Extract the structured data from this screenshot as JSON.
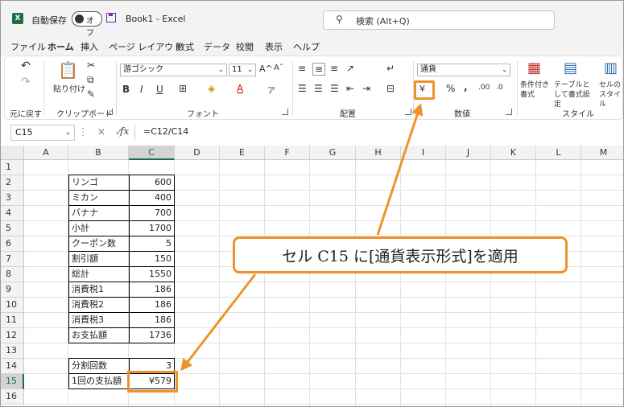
{
  "titlebar": {
    "app_icon": "X",
    "autosave_label": "自動保存",
    "autosave_state": "オフ",
    "doc_title": "Book1  -  Excel",
    "search_placeholder": "検索 (Alt+Q)"
  },
  "menu_tabs": [
    "ファイル",
    "ホーム",
    "挿入",
    "ページ レイアウト",
    "数式",
    "データ",
    "校閲",
    "表示",
    "ヘルプ"
  ],
  "active_tab": "ホーム",
  "ribbon": {
    "undo_group_label": "元に戻す",
    "paste_label": "貼り付け",
    "clipboard_label": "クリップボード",
    "font_name": "游ゴシック",
    "font_size": "11",
    "grow_font": "A^",
    "shrink_font": "Aˇ",
    "bold": "B",
    "italic": "I",
    "underline": "U",
    "phonetic": "ア",
    "font_group_label": "フォント",
    "alignment_group_label": "配置",
    "number_format": "通貨",
    "percent": "%",
    "comma": ",",
    "increase_decimal": ".00",
    "decrease_decimal": ".0",
    "number_group_label": "数値",
    "cond_format_label": "条件付き書式",
    "table_format_label": "テーブルとして書式設定",
    "cell_style_label": "セルのスタイル",
    "styles_group_label": "スタイル"
  },
  "formula_bar": {
    "name_box": "C15",
    "formula": "=C12/C14",
    "fx": "fx"
  },
  "columns": [
    "A",
    "B",
    "C",
    "D",
    "E",
    "F",
    "G",
    "H",
    "I",
    "J",
    "K",
    "L",
    "M"
  ],
  "selected_column": "C",
  "rows": [
    "1",
    "2",
    "3",
    "4",
    "5",
    "6",
    "7",
    "8",
    "9",
    "10",
    "11",
    "12",
    "13",
    "14",
    "15",
    "16"
  ],
  "selected_row": "15",
  "table": [
    {
      "row": 2,
      "label": "リンゴ",
      "value": "600"
    },
    {
      "row": 3,
      "label": "ミカン",
      "value": "400"
    },
    {
      "row": 4,
      "label": "バナナ",
      "value": "700"
    },
    {
      "row": 5,
      "label": "小計",
      "value": "1700"
    },
    {
      "row": 6,
      "label": "クーポン数",
      "value": "5"
    },
    {
      "row": 7,
      "label": "割引額",
      "value": "150"
    },
    {
      "row": 8,
      "label": "総計",
      "value": "1550"
    },
    {
      "row": 9,
      "label": "消費税1",
      "value": "186"
    },
    {
      "row": 10,
      "label": "消費税2",
      "value": "186"
    },
    {
      "row": 11,
      "label": "消費税3",
      "value": "186"
    },
    {
      "row": 12,
      "label": "お支払額",
      "value": "1736"
    },
    {
      "row": 14,
      "label": "分割回数",
      "value": "3"
    },
    {
      "row": 15,
      "label": "1回の支払額",
      "value": "¥579"
    }
  ],
  "callout": {
    "text": "セル C15 に[通貨表示形式]を適用",
    "color": "#f0922c"
  }
}
